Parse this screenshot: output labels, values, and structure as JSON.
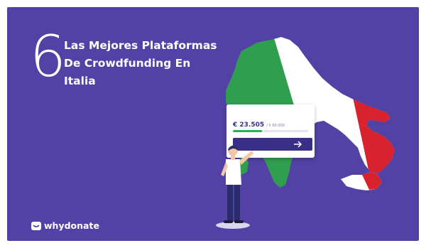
{
  "banner": {
    "number": "6",
    "title_lines": [
      "Las Mejores Plataformas",
      "De Crowdfunding En",
      "Italia"
    ]
  },
  "card": {
    "amount": "€ 23.505",
    "goal": "/ € 60.000",
    "progress": 0.39,
    "button_icon": "arrow-right-icon"
  },
  "brand": {
    "name": "whydonate",
    "logo_icon": "whydonate-logo-icon"
  },
  "colors": {
    "background": "#5242a6",
    "accent_dark": "#3a2f88",
    "italy_green": "#2f9e4f",
    "italy_white": "#ffffff",
    "italy_red": "#d8232e",
    "progress_green": "#2fae5a"
  }
}
